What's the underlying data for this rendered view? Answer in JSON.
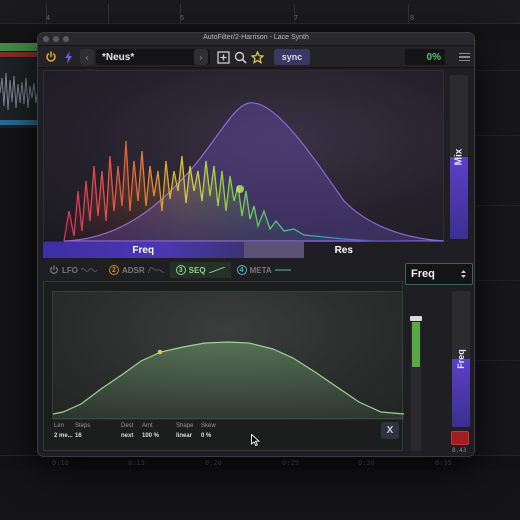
{
  "window": {
    "title": "AutoFilter/2-Harrison - Lace Synth"
  },
  "toolbar": {
    "preset_name": "*Neus*",
    "sync_label": "sync",
    "output_value": "0%",
    "icons": [
      "power-icon",
      "lightning-icon",
      "prev-preset-icon",
      "next-preset-icon",
      "add-preset-icon",
      "search-icon",
      "star-icon",
      "menu-icon"
    ]
  },
  "filter": {
    "freq_label": "Freq",
    "res_label": "Res",
    "mix_label": "Mix",
    "mix_level": 0.5,
    "freq_level": 0.5,
    "res_level": 0.15
  },
  "mod_tabs": [
    {
      "number": "",
      "label": "LFO",
      "active": false,
      "color": "#777777"
    },
    {
      "number": "2",
      "label": "ADSR",
      "active": false,
      "color": "#d08a2c"
    },
    {
      "number": "3",
      "label": "SEQ",
      "active": true,
      "color": "#8fd08a"
    },
    {
      "number": "4",
      "label": "META",
      "active": false,
      "color": "#4fbfae"
    }
  ],
  "sequencer": {
    "params": [
      {
        "label": "Len",
        "value": "2 me..."
      },
      {
        "label": "Steps",
        "value": "16"
      },
      {
        "label": "Dest",
        "value": "next"
      },
      {
        "label": "Amt",
        "value": "100 %"
      },
      {
        "label": "Shape",
        "value": "linear"
      },
      {
        "label": "Skew",
        "value": "0 %"
      }
    ],
    "close_label": "X"
  },
  "destination": {
    "label": "Freq",
    "slider_label": "Freq",
    "mod_amount": 0.33,
    "readout": "8.43"
  },
  "daw": {
    "top_ruler": [
      "4",
      "5",
      "6",
      "7",
      "8"
    ],
    "bottom_ruler": [
      "0:10",
      "0:15",
      "0:20",
      "0:25",
      "0:30",
      "0:35"
    ]
  },
  "colors": {
    "accent": "#5b40c9",
    "seq_green": "#8fd08a",
    "output_green": "#58c26a"
  }
}
